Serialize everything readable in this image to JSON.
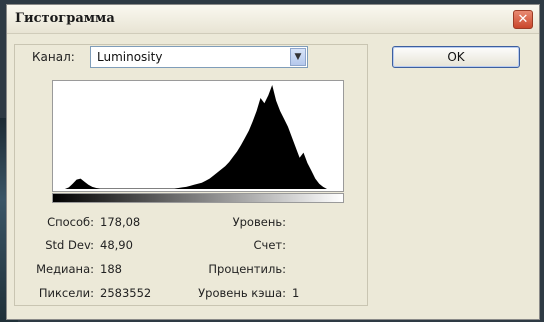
{
  "dialog": {
    "title": "Гистограмма",
    "close_glyph": "✕"
  },
  "channel": {
    "label": "Канал:",
    "selected": "Luminosity"
  },
  "buttons": {
    "ok": "OK"
  },
  "histogram": {
    "bins": [
      0,
      0,
      3,
      10,
      18,
      20,
      14,
      8,
      4,
      2,
      1,
      1,
      1,
      1,
      1,
      1,
      1,
      1,
      1,
      1,
      1,
      1,
      1,
      1,
      1,
      1,
      1,
      1,
      1,
      1,
      2,
      3,
      4,
      6,
      8,
      10,
      12,
      16,
      20,
      26,
      32,
      38,
      44,
      52,
      62,
      72,
      84,
      98,
      112,
      130,
      150,
      175,
      165,
      180,
      200,
      170,
      150,
      135,
      120,
      100,
      80,
      60,
      70,
      50,
      35,
      20,
      10,
      4,
      0
    ],
    "colors": {
      "fill": "#000000",
      "background": "#ffffff"
    }
  },
  "stats": {
    "mean_label": "Способ:",
    "mean_value": "178,08",
    "stddev_label": "Std Dev:",
    "stddev_value": "48,90",
    "median_label": "Медиана:",
    "median_value": "188",
    "pixels_label": "Пиксели:",
    "pixels_value": "2583552",
    "level_label": "Уровень:",
    "level_value": "",
    "count_label": "Счет:",
    "count_value": "",
    "percentile_label": "Процентиль:",
    "percentile_value": "",
    "cache_label": "Уровень кэша:",
    "cache_value": "1"
  }
}
